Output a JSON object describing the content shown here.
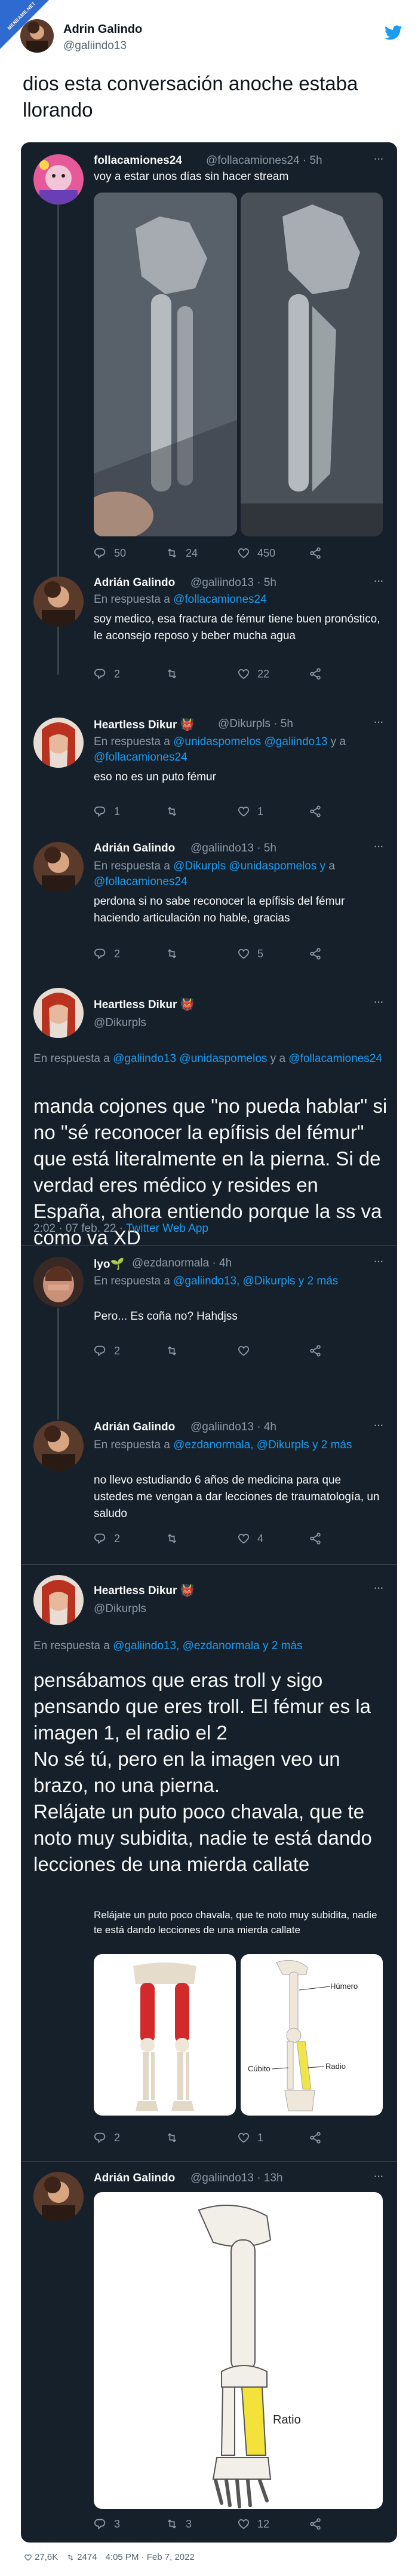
{
  "badge": {
    "text": "MENEAME.NET"
  },
  "outer": {
    "name": "Adrin Galindo",
    "handle": "@galiindo13",
    "text": "dios esta conversación anoche estaba llorando",
    "footer": {
      "likes": "27,6K",
      "retweets": "2474",
      "time": "4:05 PM · Feb 7, 2022"
    }
  },
  "t1": {
    "name": "follacamiones24",
    "handle": "@follacamiones24 · 5h",
    "text": "voy a estar unos días sin hacer stream",
    "replies": "50",
    "retweets": "24",
    "likes": "450"
  },
  "t2": {
    "name": "Adrián Galindo",
    "handle": "@galiindo13 · 5h",
    "reply_prefix": "En respuesta a ",
    "reply_to": "@follacamiones24",
    "text": "soy medico, esa fractura de fémur tiene buen pronóstico, le aconsejo reposo y beber mucha agua",
    "replies": "2",
    "retweets": "",
    "likes": "22"
  },
  "t3": {
    "name": "Heartless Dikur 👹",
    "handle": "@Dikurpls · 5h",
    "reply_prefix": "En respuesta a ",
    "reply_to": "@unidaspomelos @galiindo13",
    "reply_mid": " y a ",
    "reply_to2": "@follacamiones24",
    "text": "eso no es un puto fémur",
    "replies": "1",
    "retweets": "",
    "likes": "1"
  },
  "t4": {
    "name": "Adrián Galindo",
    "handle": "@galiindo13 · 5h",
    "reply_prefix": "En respuesta a ",
    "reply_to": "@Dikurpls @unidaspomelos y",
    "reply_mid": " a ",
    "reply_to2": "@follacamiones24",
    "text": "perdona si no sabe reconocer la epífisis del fémur haciendo articulación no hable, gracias",
    "replies": "2",
    "retweets": "",
    "likes": "5"
  },
  "t5": {
    "name": "Heartless Dikur 👹",
    "handle": "@Dikurpls",
    "reply_prefix": "En respuesta a ",
    "reply_to": "@galiindo13 @unidaspomelos",
    "reply_mid": " y a ",
    "reply_to2": "@follacamiones24",
    "text": "manda cojones que \"no pueda hablar\" si no \"sé reconocer la epífisis del fémur\" que está literalmente en la pierna. Si de verdad eres médico y resides en España, ahora entiendo porque la ss va como va XD",
    "meta_time": "2:02 · 07 feb. 22 · ",
    "meta_app": "Twitter Web App"
  },
  "t6": {
    "name": "lyo🌱",
    "handle": "@ezdanormala · 4h",
    "reply_prefix": "En respuesta a ",
    "reply_to": "@galiindo13, @Dikurpls y 2 más",
    "text": "Pero... Es coña no? Hahdjss",
    "replies": "2",
    "retweets": "",
    "likes": ""
  },
  "t7": {
    "name": "Adrián Galindo",
    "handle": "@galiindo13 · 4h",
    "reply_prefix": "En respuesta a ",
    "reply_to": "@ezdanormala, @Dikurpls y 2 más",
    "text": "no llevo estudiando 6 años de medicina para que ustedes me vengan a dar lecciones de traumatología, un saludo",
    "replies": "2",
    "retweets": "",
    "likes": "4"
  },
  "t8": {
    "name": "Heartless Dikur 👹",
    "handle": "@Dikurpls",
    "reply_prefix": "En respuesta a ",
    "reply_to": "@galiindo13, @ezdanormala y 2 más",
    "text": "pensábamos que eras troll y sigo pensando que eres troll. El fémur es la imagen 1, el radio el 2\nNo sé tú, pero en la imagen veo un brazo, no una pierna.\nRelájate un puto poco chavala, que te noto muy subidita, nadie te está dando lecciones de una mierda callate",
    "quote": "Relájate un puto poco chavala, que te noto muy subidita, nadie te está dando lecciones de una mierda callate",
    "label_humero": "Húmero",
    "label_cubito": "Cúbito",
    "label_radio": "Radio",
    "replies": "2",
    "retweets": "",
    "likes": "1"
  },
  "t9": {
    "name": "Adrián Galindo",
    "handle": "@galiindo13 · 13h",
    "label_ratio": "Ratio",
    "replies": "3",
    "retweets": "3",
    "likes": "12"
  },
  "colors": {
    "bg": "#15202b",
    "text": "#f7f9f9",
    "muted": "#8b98a5",
    "link": "#1d9bf0",
    "brand": "#1d9bf0"
  }
}
